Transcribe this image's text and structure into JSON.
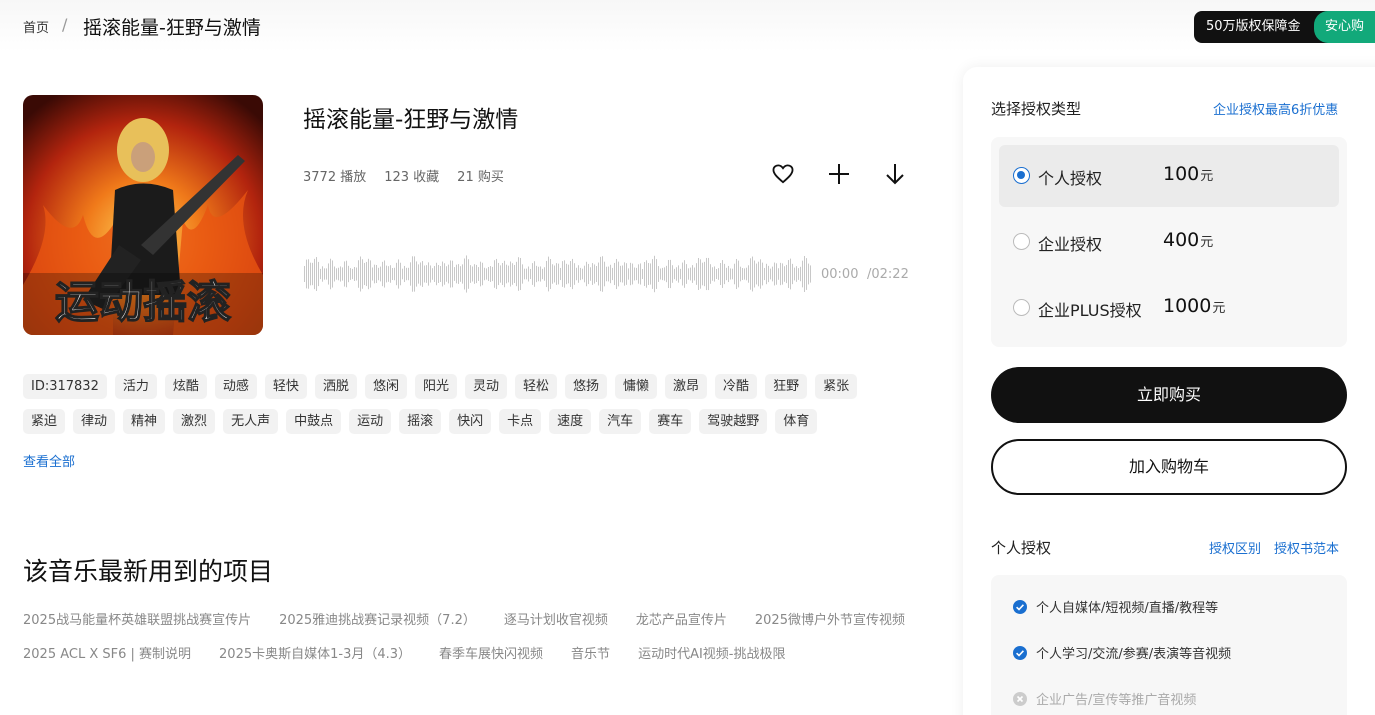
{
  "breadcrumb": {
    "home": "首页",
    "separator": "/",
    "current": "摇滚能量-狂野与激情"
  },
  "guarantee": {
    "left": "50万版权保障金",
    "right": "安心购"
  },
  "cover": {
    "caption": "运动摇滚"
  },
  "song": {
    "title": "摇滚能量-狂野与激情",
    "plays": "3772 播放",
    "favorites": "123 收藏",
    "purchases": "21 购买",
    "time_current": "00:00",
    "time_total": "/02:22"
  },
  "actions": {
    "favorite_icon": "heart-icon",
    "add_icon": "plus-icon",
    "download_icon": "arrow-down-icon"
  },
  "tags": [
    "ID:317832",
    "活力",
    "炫酷",
    "动感",
    "轻快",
    "洒脱",
    "悠闲",
    "阳光",
    "灵动",
    "轻松",
    "悠扬",
    "慵懒",
    "激昂",
    "冷酷",
    "狂野",
    "紧张",
    "紧迫",
    "律动",
    "精神",
    "激烈",
    "无人声",
    "中鼓点",
    "运动",
    "摇滚",
    "快闪",
    "卡点",
    "速度",
    "汽车",
    "赛车",
    "驾驶越野",
    "体育"
  ],
  "see_all": "查看全部",
  "projects": {
    "title": "该音乐最新用到的项目",
    "items": [
      "2025战马能量杯英雄联盟挑战赛宣传片",
      "2025雅迪挑战赛记录视频（7.2）",
      "逐马计划收官视频",
      "龙芯产品宣传片",
      "2025微博户外节宣传视频",
      "2025 ACL X SF6 | 赛制说明",
      "2025卡奥斯自媒体1-3月（4.3）",
      "春季车展快闪视频",
      "音乐节",
      "运动时代AI视频-挑战极限"
    ]
  },
  "license": {
    "label": "选择授权类型",
    "promo": "企业授权最高6折优惠",
    "options": [
      {
        "name": "个人授权",
        "price": "100",
        "unit": "元",
        "selected": true
      },
      {
        "name": "企业授权",
        "price": "400",
        "unit": "元",
        "selected": false
      },
      {
        "name": "企业PLUS授权",
        "price": "1000",
        "unit": "元",
        "selected": false
      }
    ],
    "buy": "立即购买",
    "cart": "加入购物车"
  },
  "scope": {
    "title": "个人授权",
    "links": [
      "授权区别",
      "授权书范本"
    ],
    "uses": [
      {
        "text": "个人自媒体/短视频/直播/教程等",
        "allowed": true
      },
      {
        "text": "个人学习/交流/参赛/表演等音视频",
        "allowed": true
      },
      {
        "text": "企业广告/宣传等推广音视频",
        "allowed": false
      }
    ]
  },
  "colors": {
    "accent_blue": "#1a6fd0",
    "guarantee_green": "#12a97a",
    "button_black": "#111111"
  }
}
